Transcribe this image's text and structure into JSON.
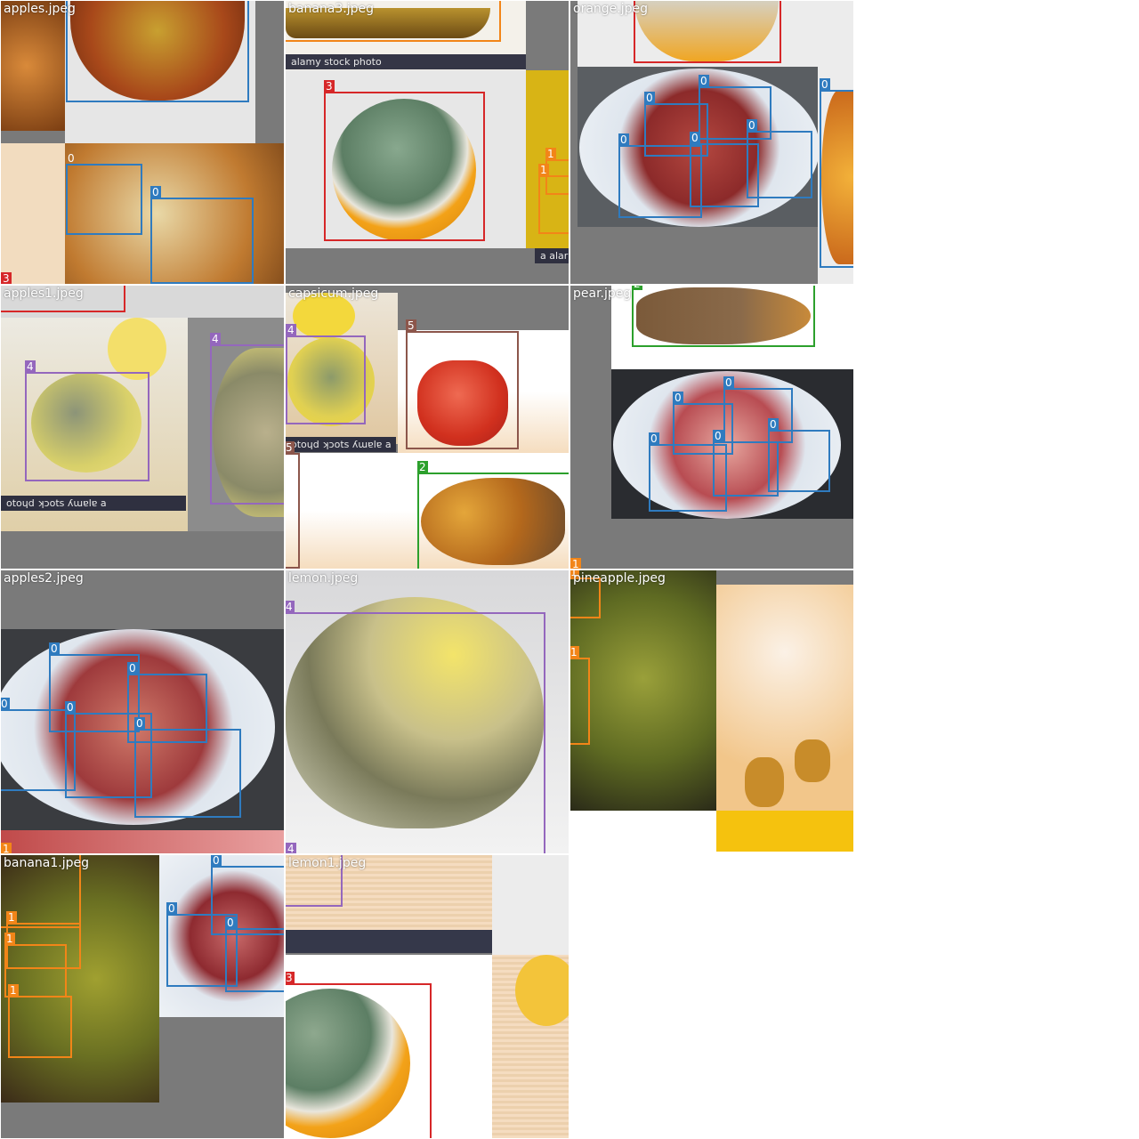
{
  "colors": {
    "c0": "#2f7bbf",
    "c1": "#f28518",
    "c2": "#2ca02c",
    "c3": "#d62728",
    "c4": "#9467bd",
    "c5": "#8c564b"
  },
  "tiles": [
    {
      "label": "apples.jpeg"
    },
    {
      "label": "banana3.jpeg"
    },
    {
      "label": "orange.jpeg"
    },
    {
      "label": "apples1.jpeg"
    },
    {
      "label": "capsicum.jpeg"
    },
    {
      "label": "pear.jpeg"
    },
    {
      "label": "apples2.jpeg"
    },
    {
      "label": "lemon.jpeg"
    },
    {
      "label": "pineapple.jpeg"
    },
    {
      "label": "banana1.jpeg"
    },
    {
      "label": "lemon1.jpeg"
    }
  ],
  "watermarks": {
    "alamy": "alamy stock photo",
    "alamy_short": "a  alar",
    "alamy_mirror": "otoɥd ʞɔots ʎɯɐlɐ a"
  },
  "classes": [
    "0",
    "1",
    "2",
    "3",
    "4",
    "5"
  ]
}
